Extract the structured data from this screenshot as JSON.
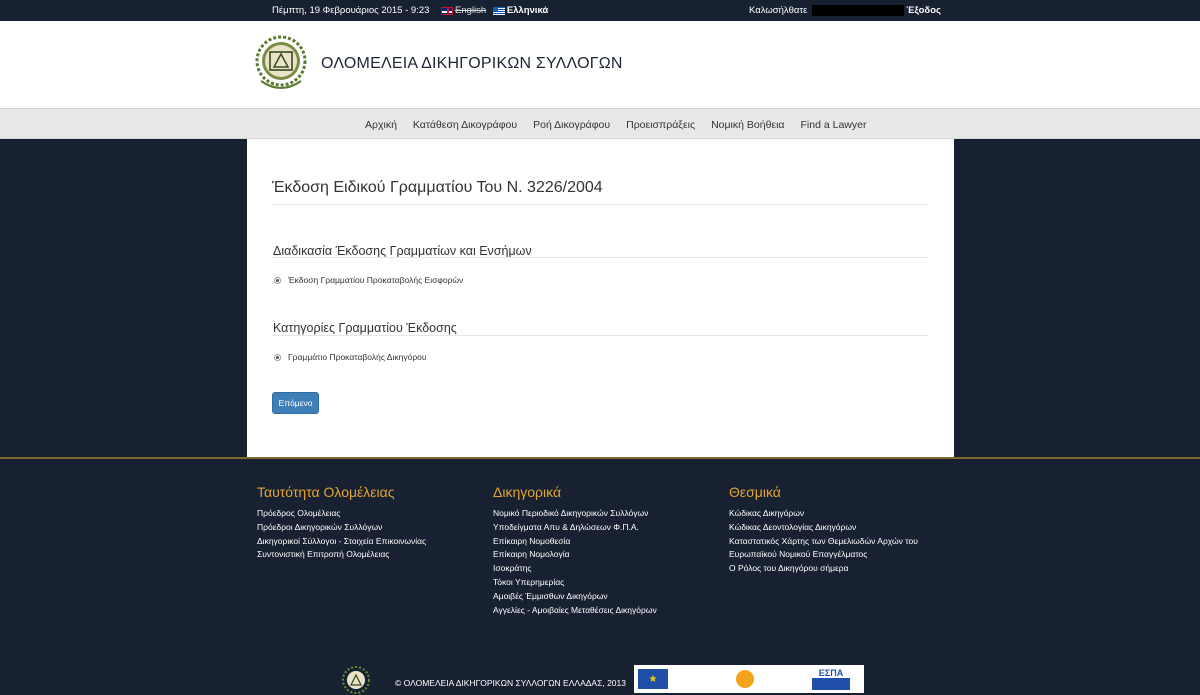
{
  "topbar": {
    "date": "Πέμπτη, 19 Φεβρουάριος 2015 - 9:23",
    "lang_en": "English",
    "lang_el": "Ελληνικά",
    "welcome": "Καλωσήλθατε",
    "logout": "Έξοδος"
  },
  "header": {
    "title": "ΟΛΟΜΕΛΕΙΑ ΔΙΚΗΓΟΡΙΚΩΝ ΣΥΛΛΟΓΩΝ"
  },
  "nav": {
    "items": [
      "Αρχική",
      "Κατάθεση Δικογράφου",
      "Ροή Δικογράφου",
      "Προεισπράξεις",
      "Νομική Βοήθεια",
      "Find a Lawyer"
    ]
  },
  "main": {
    "title": "Έκδοση Ειδικού Γραμματίου Του Ν. 3226/2004",
    "section1": {
      "heading": "Διαδικασία Έκδοσης Γραμματίων και Ενσήμων",
      "option": "Έκδοση Γραμματίου Προκαταβολής Εισφορών"
    },
    "section2": {
      "heading": "Κατηγορίες Γραμματίου Έκδοσης",
      "option": "Γραμμάτιο Προκαταβολής Δικηγόρου"
    },
    "next_button": "Επόμενο"
  },
  "footer": {
    "col1": {
      "title": "Ταυτότητα Ολομέλειας",
      "links": [
        "Πρόεδρος Ολομέλειας",
        "Πρόεδροι Δικηγορικών Συλλόγων",
        "Δικηγορικοί Σύλλογοι - Στοιχεία Επικοινωνίας",
        "Συντονιστική Επιτροπή Ολομέλειας"
      ]
    },
    "col2": {
      "title": "Δικηγορικά",
      "links": [
        "Νομικό Περιοδικό Δικηγορικών Συλλόγων",
        "Υποδείγματα Απυ & Δηλώσεων Φ.Π.Α.",
        "Επίκαιρη Νομοθεσία",
        "Επίκαιρη Νομολογία",
        "Ισοκράτης",
        "Τόκοι Υπερημερίας",
        "Αμοιβές Έμμισθων Δικηγόρων",
        "Αγγελίες - Αμοιβαίες Μεταθέσεις Δικηγόρων"
      ]
    },
    "col3": {
      "title": "Θεσμικά",
      "links": [
        "Κώδικας Δικηγόρων",
        "Κώδικας Δεοντολογίας Δικηγόρων",
        "Καταστατικός Χάρτης των Θεμελιωδών Αρχών του",
        "Ευρωπαϊκού Νομικού Επαγγέλματος",
        "Ο Ρόλος του Δικηγόρου σήμερα"
      ]
    },
    "copyright": "© ΟΛΟΜΕΛΕΙΑ ΔΙΚΗΓΟΡΙΚΩΝ ΣΥΛΛΟΓΩΝ ΕΛΛΑΔΑΣ, 2013",
    "espa_logo": "ΕΣΠΑ"
  },
  "colors": {
    "dark_bg": "#182132",
    "accent_gold": "#e3a431",
    "button_blue": "#3f7fb8"
  }
}
